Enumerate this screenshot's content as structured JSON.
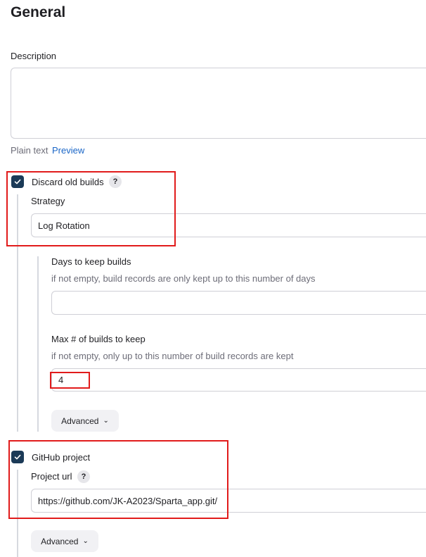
{
  "section": {
    "title": "General"
  },
  "description": {
    "label": "Description",
    "value": "",
    "plain_text": "Plain text",
    "preview_link": "Preview"
  },
  "discard_old_builds": {
    "label": "Discard old builds",
    "checked": true,
    "help": "?",
    "strategy_label": "Strategy",
    "strategy_value": "Log Rotation",
    "days_label": "Days to keep builds",
    "days_help": "if not empty, build records are only kept up to this number of days",
    "days_value": "",
    "max_label": "Max # of builds to keep",
    "max_help": "if not empty, only up to this number of build records are kept",
    "max_value": "4",
    "advanced": "Advanced"
  },
  "github_project": {
    "label": "GitHub project",
    "checked": true,
    "url_label": "Project url",
    "help": "?",
    "url_value": "https://github.com/JK-A2023/Sparta_app.git/",
    "advanced": "Advanced"
  },
  "colors": {
    "checkbox": "#1b3a57",
    "link": "#1a66c7",
    "highlight": "#e11b1b"
  }
}
